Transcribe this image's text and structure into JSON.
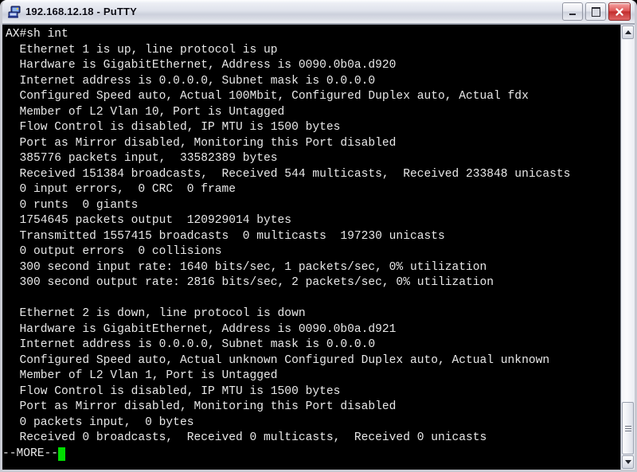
{
  "window": {
    "title": "192.168.12.18 - PuTTY",
    "icon": "putty-icon",
    "buttons": {
      "minimize_label": "_",
      "maximize_label": "□",
      "close_label": "×"
    }
  },
  "terminal": {
    "foreground_color": "#e8e8e8",
    "background_color": "#000000",
    "cursor_color": "#00dd00",
    "lines": [
      "AX#sh int",
      "  Ethernet 1 is up, line protocol is up",
      "  Hardware is GigabitEthernet, Address is 0090.0b0a.d920",
      "  Internet address is 0.0.0.0, Subnet mask is 0.0.0.0",
      "  Configured Speed auto, Actual 100Mbit, Configured Duplex auto, Actual fdx",
      "  Member of L2 Vlan 10, Port is Untagged",
      "  Flow Control is disabled, IP MTU is 1500 bytes",
      "  Port as Mirror disabled, Monitoring this Port disabled",
      "  385776 packets input,  33582389 bytes",
      "  Received 151384 broadcasts,  Received 544 multicasts,  Received 233848 unicasts",
      "  0 input errors,  0 CRC  0 frame",
      "  0 runts  0 giants",
      "  1754645 packets output  120929014 bytes",
      "  Transmitted 1557415 broadcasts  0 multicasts  197230 unicasts",
      "  0 output errors  0 collisions",
      "  300 second input rate: 1640 bits/sec, 1 packets/sec, 0% utilization",
      "  300 second output rate: 2816 bits/sec, 2 packets/sec, 0% utilization",
      "",
      "  Ethernet 2 is down, line protocol is down",
      "  Hardware is GigabitEthernet, Address is 0090.0b0a.d921",
      "  Internet address is 0.0.0.0, Subnet mask is 0.0.0.0",
      "  Configured Speed auto, Actual unknown Configured Duplex auto, Actual unknown",
      "  Member of L2 Vlan 1, Port is Untagged",
      "  Flow Control is disabled, IP MTU is 1500 bytes",
      "  Port as Mirror disabled, Monitoring this Port disabled",
      "  0 packets input,  0 bytes",
      "  Received 0 broadcasts,  Received 0 multicasts,  Received 0 unicasts"
    ],
    "more_prompt": "--MORE--"
  },
  "scrollbar": {
    "up_arrow": "scroll-up",
    "down_arrow": "scroll-down",
    "position": "bottom"
  }
}
